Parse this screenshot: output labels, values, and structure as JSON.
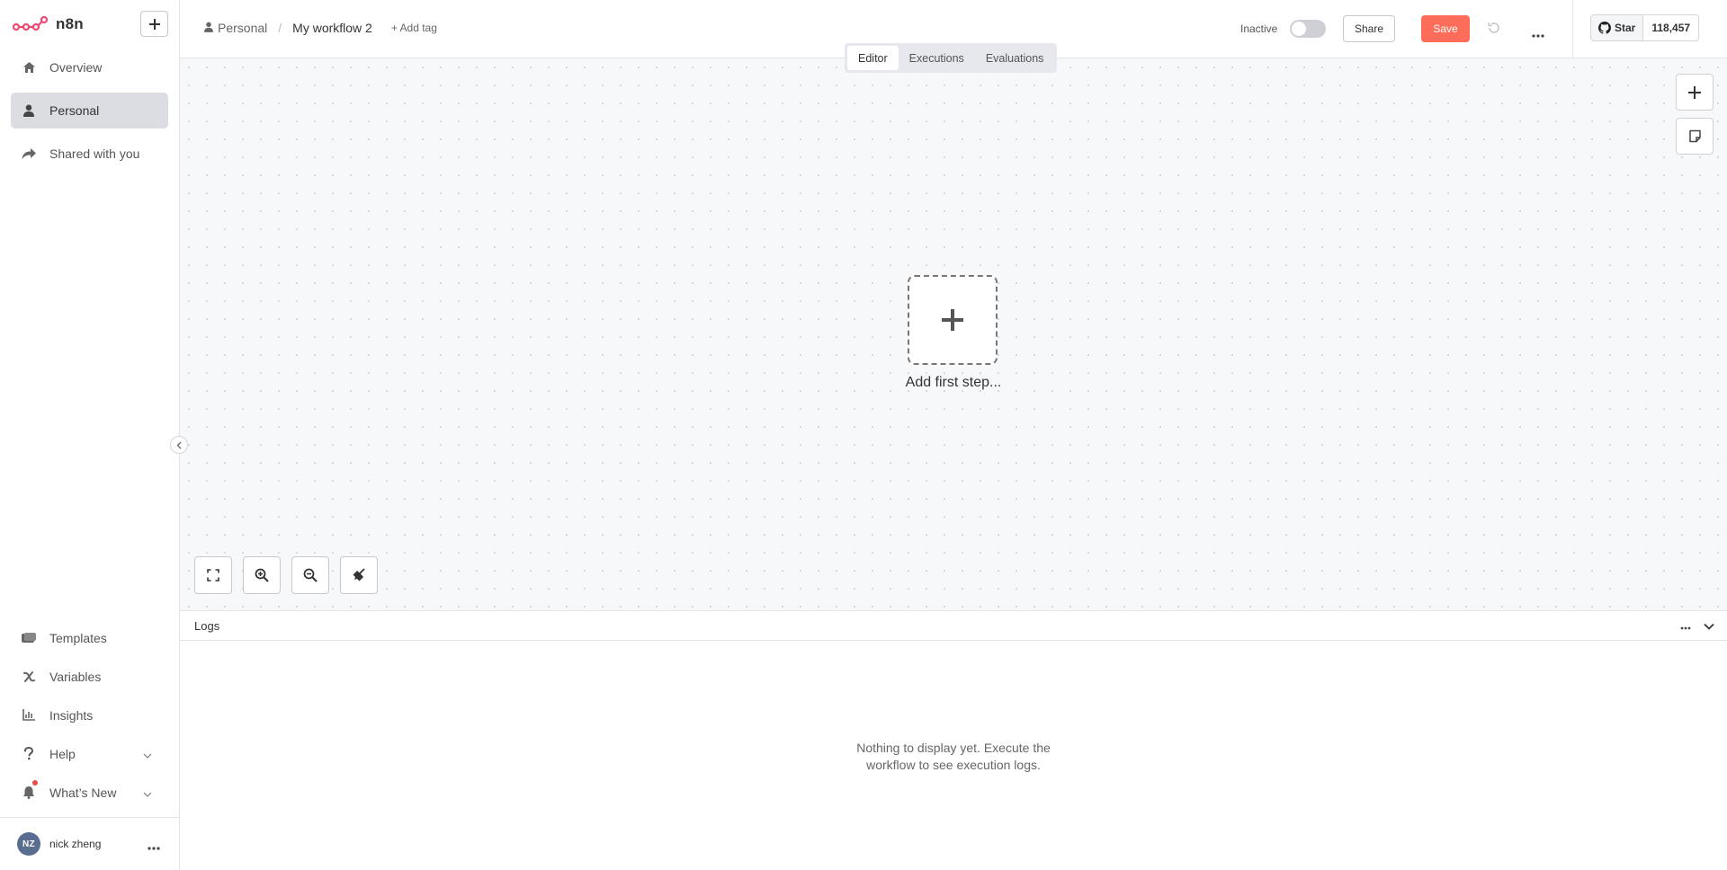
{
  "brand": {
    "name": "n8n"
  },
  "sidebar": {
    "add_label": "+",
    "top_items": [
      {
        "label": "Overview",
        "icon": "home-icon"
      },
      {
        "label": "Personal",
        "icon": "user-icon"
      },
      {
        "label": "Shared with you",
        "icon": "share-icon"
      }
    ],
    "bottom_items": [
      {
        "label": "Templates",
        "icon": "templates-icon"
      },
      {
        "label": "Variables",
        "icon": "variables-icon"
      },
      {
        "label": "Insights",
        "icon": "insights-icon"
      },
      {
        "label": "Help",
        "icon": "help-icon"
      },
      {
        "label": "What’s New",
        "icon": "bell-icon"
      }
    ],
    "user": {
      "initials": "NZ",
      "name": "nick zheng"
    }
  },
  "header": {
    "project": "Personal",
    "workflow_name": "My workflow 2",
    "add_tag": "+ Add tag",
    "status": "Inactive",
    "share": "Share",
    "save": "Save",
    "github": {
      "star": "Star",
      "count": "118,457"
    }
  },
  "tabs": [
    {
      "label": "Editor",
      "active": true
    },
    {
      "label": "Executions",
      "active": false
    },
    {
      "label": "Evaluations",
      "active": false
    }
  ],
  "canvas": {
    "add_first_step": "Add first step...",
    "background": "#f7f8fa"
  },
  "logs": {
    "title": "Logs",
    "empty_line1": "Nothing to display yet. Execute the",
    "empty_line2": "workflow to see execution logs."
  },
  "colors": {
    "accent": "#ff6d5a",
    "brand": "#ea4b71"
  }
}
